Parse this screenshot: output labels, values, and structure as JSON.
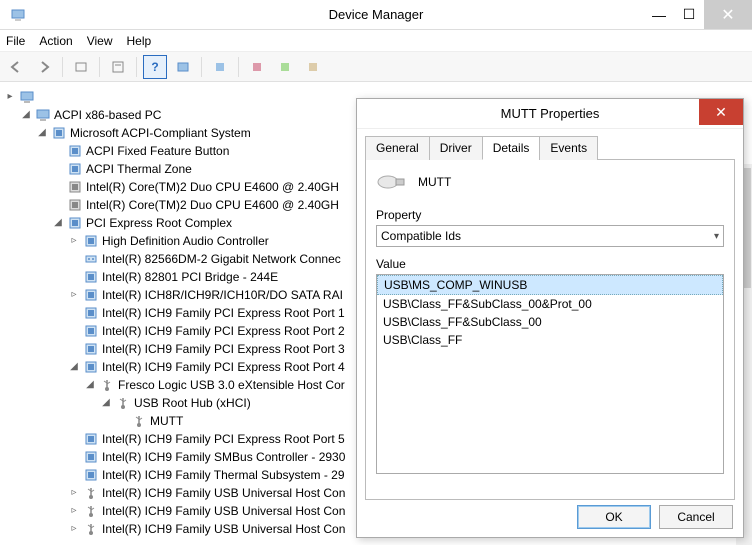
{
  "window": {
    "title": "Device Manager",
    "min": "—",
    "max": "☐",
    "close": "✕"
  },
  "menu": {
    "file": "File",
    "action": "Action",
    "view": "View",
    "help": "Help"
  },
  "toolbar_icons": [
    "back",
    "forward",
    "up",
    "show",
    "help",
    "prop",
    "scan",
    "update",
    "uninstall",
    "enable"
  ],
  "tree": [
    {
      "depth": 0,
      "twisty": "▸",
      "icon": "pc",
      "label": ""
    },
    {
      "depth": 1,
      "twisty": "◢",
      "icon": "pc",
      "label": "ACPI x86-based PC"
    },
    {
      "depth": 2,
      "twisty": "◢",
      "icon": "chip",
      "label": "Microsoft ACPI-Compliant System"
    },
    {
      "depth": 3,
      "twisty": "",
      "icon": "chip",
      "label": "ACPI Fixed Feature Button"
    },
    {
      "depth": 3,
      "twisty": "",
      "icon": "chip",
      "label": "ACPI Thermal Zone"
    },
    {
      "depth": 3,
      "twisty": "",
      "icon": "cpu",
      "label": "Intel(R) Core(TM)2 Duo CPU    E4600  @ 2.40GH"
    },
    {
      "depth": 3,
      "twisty": "",
      "icon": "cpu",
      "label": "Intel(R) Core(TM)2 Duo CPU    E4600  @ 2.40GH"
    },
    {
      "depth": 3,
      "twisty": "◢",
      "icon": "chip",
      "label": "PCI Express Root Complex"
    },
    {
      "depth": 4,
      "twisty": "▹",
      "icon": "chip",
      "label": "High Definition Audio Controller"
    },
    {
      "depth": 4,
      "twisty": "",
      "icon": "net",
      "label": "Intel(R) 82566DM-2 Gigabit Network Connec"
    },
    {
      "depth": 4,
      "twisty": "",
      "icon": "chip",
      "label": "Intel(R) 82801 PCI Bridge - 244E"
    },
    {
      "depth": 4,
      "twisty": "▹",
      "icon": "chip",
      "label": "Intel(R) ICH8R/ICH9R/ICH10R/DO SATA RAI"
    },
    {
      "depth": 4,
      "twisty": "",
      "icon": "chip",
      "label": "Intel(R) ICH9 Family PCI Express Root Port 1"
    },
    {
      "depth": 4,
      "twisty": "",
      "icon": "chip",
      "label": "Intel(R) ICH9 Family PCI Express Root Port 2"
    },
    {
      "depth": 4,
      "twisty": "",
      "icon": "chip",
      "label": "Intel(R) ICH9 Family PCI Express Root Port 3"
    },
    {
      "depth": 4,
      "twisty": "◢",
      "icon": "chip",
      "label": "Intel(R) ICH9 Family PCI Express Root Port 4"
    },
    {
      "depth": 5,
      "twisty": "◢",
      "icon": "usb",
      "label": "Fresco Logic USB 3.0 eXtensible Host Cor"
    },
    {
      "depth": 6,
      "twisty": "◢",
      "icon": "usb",
      "label": "USB Root Hub (xHCI)"
    },
    {
      "depth": 7,
      "twisty": "",
      "icon": "usb",
      "label": "MUTT"
    },
    {
      "depth": 4,
      "twisty": "",
      "icon": "chip",
      "label": "Intel(R) ICH9 Family PCI Express Root Port 5"
    },
    {
      "depth": 4,
      "twisty": "",
      "icon": "chip",
      "label": "Intel(R) ICH9 Family SMBus Controller - 2930"
    },
    {
      "depth": 4,
      "twisty": "",
      "icon": "chip",
      "label": "Intel(R) ICH9 Family Thermal Subsystem - 29"
    },
    {
      "depth": 4,
      "twisty": "▹",
      "icon": "usb",
      "label": "Intel(R) ICH9 Family USB Universal Host Con"
    },
    {
      "depth": 4,
      "twisty": "▹",
      "icon": "usb",
      "label": "Intel(R) ICH9 Family USB Universal Host Con"
    },
    {
      "depth": 4,
      "twisty": "▹",
      "icon": "usb",
      "label": "Intel(R) ICH9 Family USB Universal Host Con"
    }
  ],
  "dialog": {
    "title": "MUTT Properties",
    "tabs": {
      "general": "General",
      "driver": "Driver",
      "details": "Details",
      "events": "Events"
    },
    "device_name": "MUTT",
    "property_label": "Property",
    "property_value": "Compatible Ids",
    "value_label": "Value",
    "values": [
      "USB\\MS_COMP_WINUSB",
      "USB\\Class_FF&SubClass_00&Prot_00",
      "USB\\Class_FF&SubClass_00",
      "USB\\Class_FF"
    ],
    "selected_value_index": 0,
    "ok": "OK",
    "cancel": "Cancel"
  }
}
